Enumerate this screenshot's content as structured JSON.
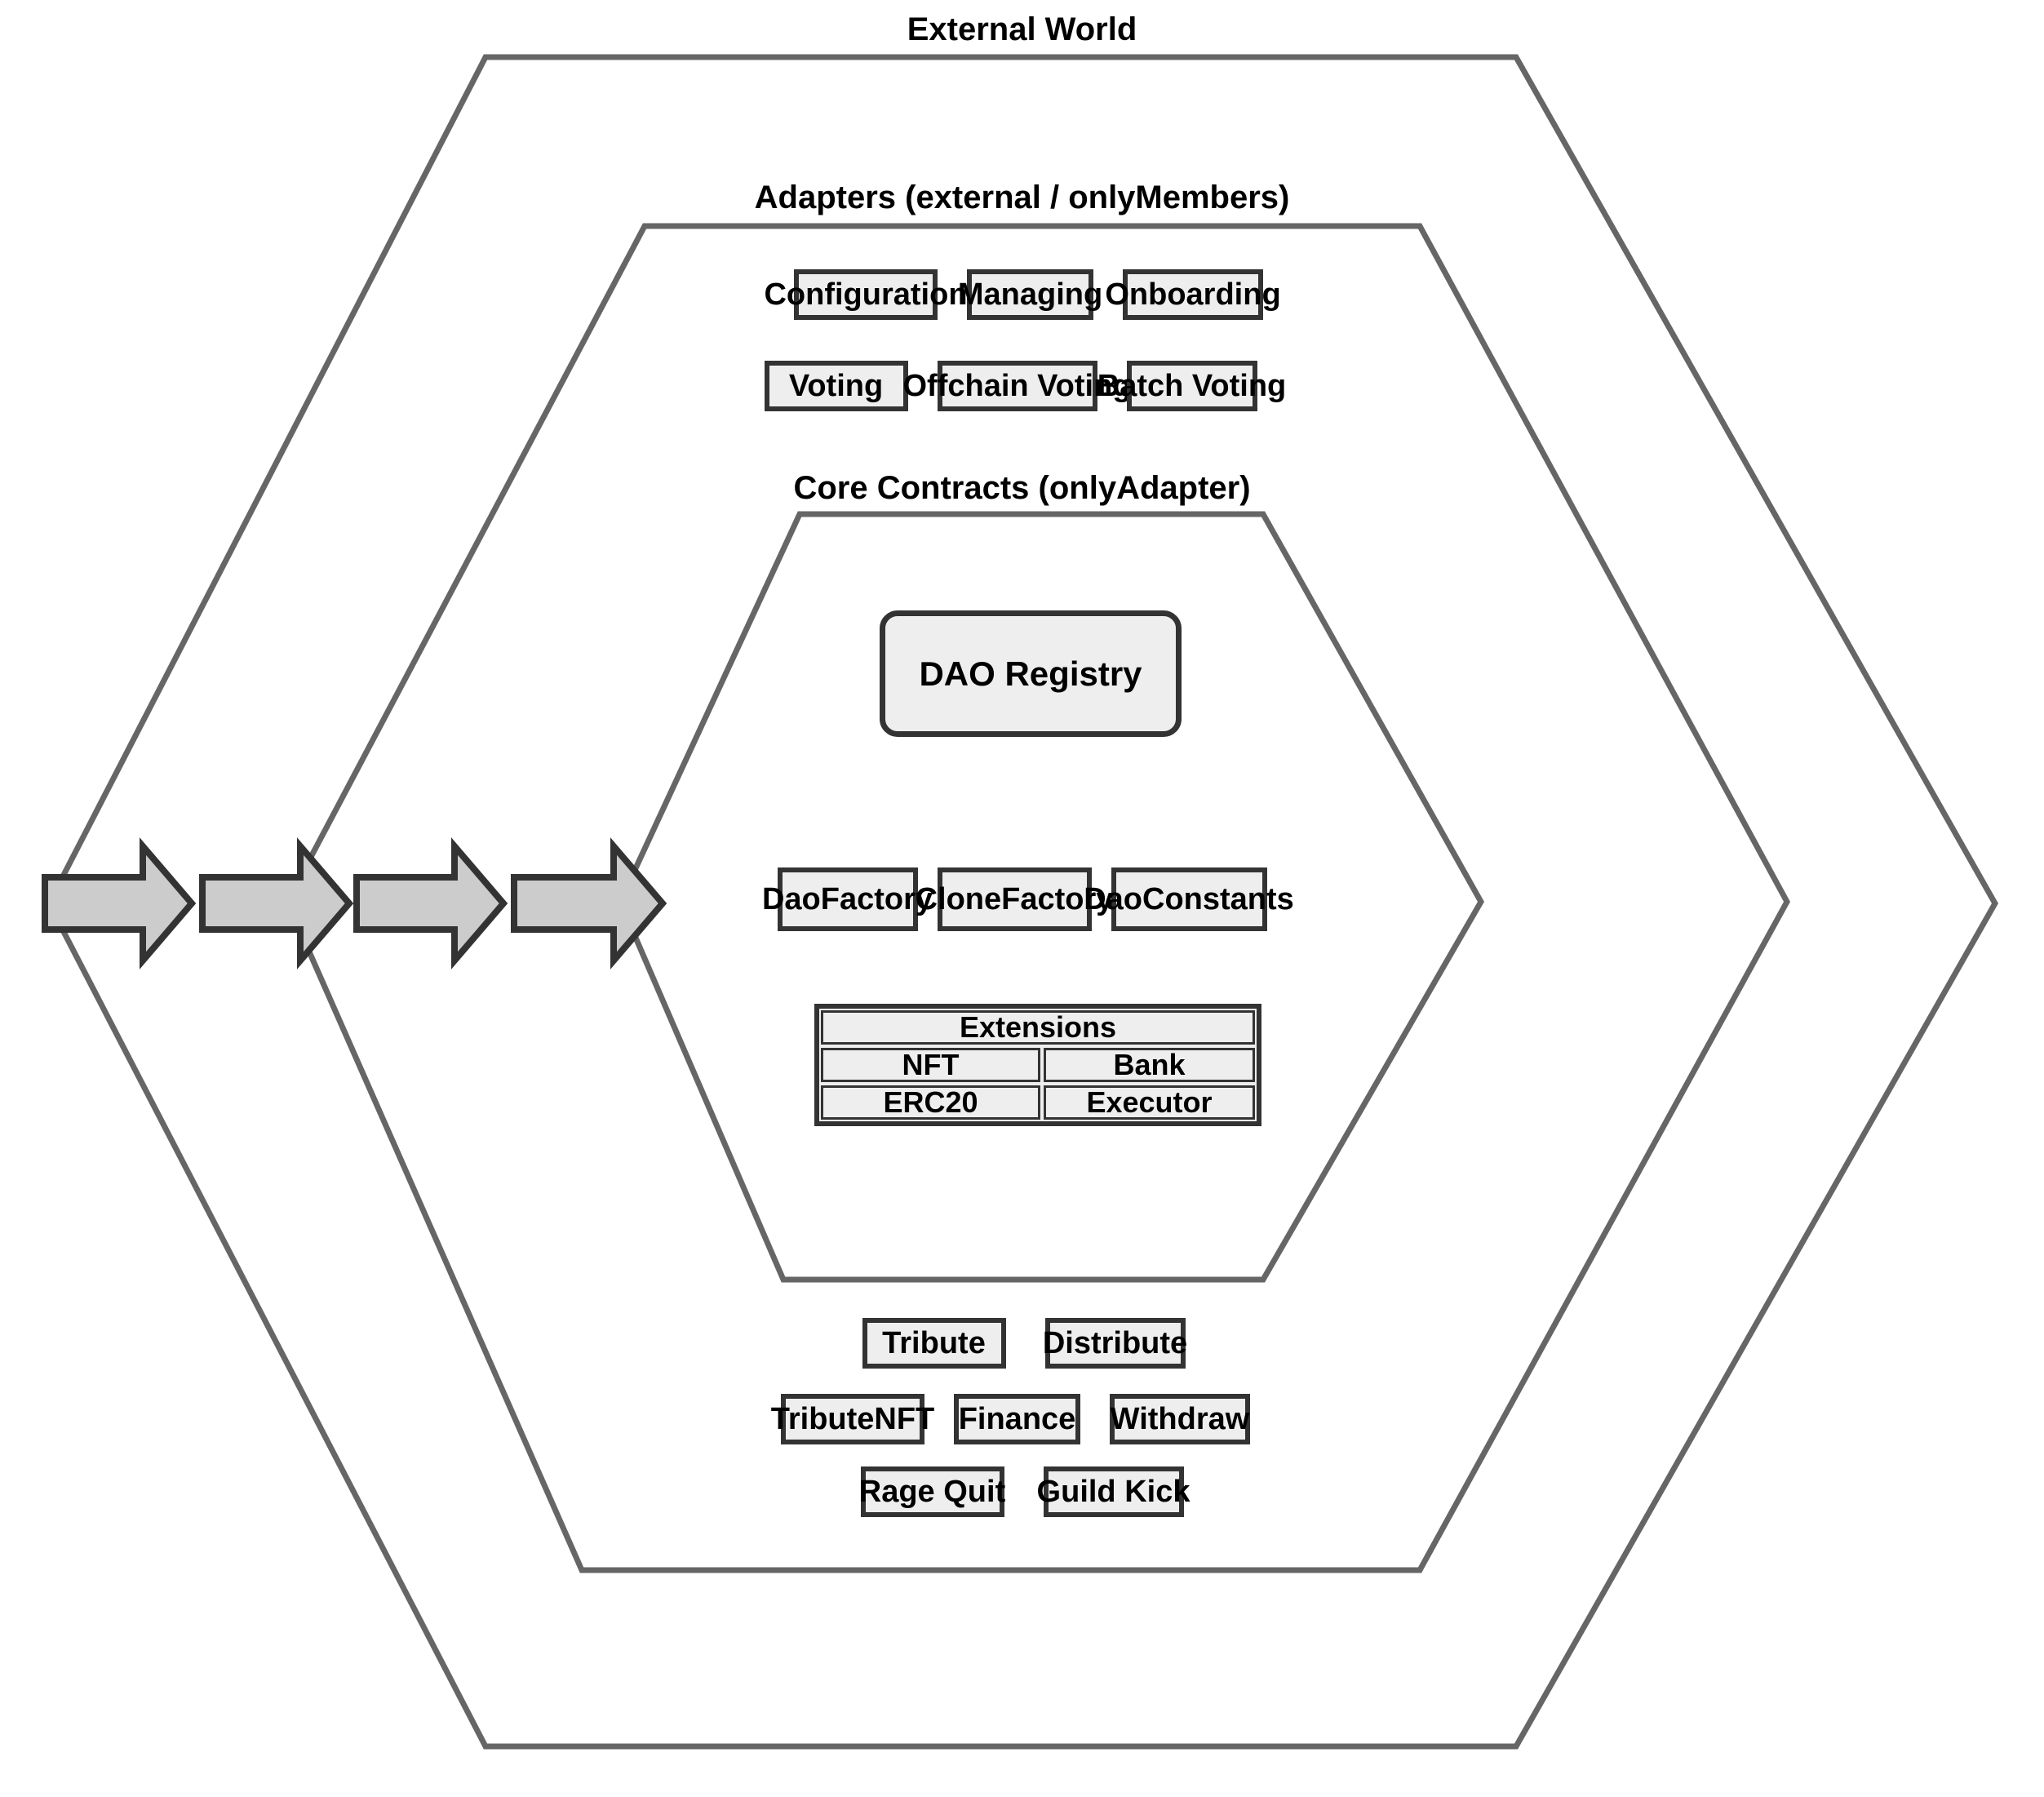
{
  "diagram": {
    "type": "layered-hexagon-architecture",
    "layers": [
      {
        "id": "external",
        "title": "External World"
      },
      {
        "id": "adapters",
        "title": "Adapters (external / onlyMembers)"
      },
      {
        "id": "core",
        "title": "Core Contracts (onlyAdapter)"
      }
    ],
    "colors": {
      "hexagon_stroke": "#666666",
      "node_fill": "#eeeeee",
      "node_stroke": "#333333",
      "arrow_fill": "#cccccc",
      "arrow_stroke": "#333333",
      "text": "#000000",
      "background": "#ffffff"
    }
  },
  "external": {
    "title": "External World"
  },
  "adapters": {
    "title": "Adapters (external / onlyMembers)",
    "top_rows": [
      {
        "items": [
          {
            "label": "Configuration",
            "width": 176
          },
          {
            "label": "Managing",
            "width": 155
          },
          {
            "label": "Onboarding",
            "width": 172
          }
        ],
        "gap": 36
      },
      {
        "items": [
          {
            "label": "Voting",
            "width": 176
          },
          {
            "label": "Offchain Voting",
            "width": 196
          },
          {
            "label": "Batch Voting",
            "width": 160
          }
        ],
        "gap": 36
      }
    ],
    "bottom_rows": [
      {
        "items": [
          {
            "label": "Tribute",
            "width": 176
          },
          {
            "label": "Distribute",
            "width": 172
          }
        ],
        "gap": 48
      },
      {
        "items": [
          {
            "label": "TributeNFT",
            "width": 176
          },
          {
            "label": "Finance",
            "width": 155
          },
          {
            "label": "Withdraw",
            "width": 172
          }
        ],
        "gap": 36
      },
      {
        "items": [
          {
            "label": "Rage Quit",
            "width": 176
          },
          {
            "label": "Guild Kick",
            "width": 172
          }
        ],
        "gap": 48
      }
    ]
  },
  "core": {
    "title": "Core Contracts (onlyAdapter)",
    "registry": {
      "label": "DAO Registry"
    },
    "factories": [
      {
        "label": "DaoFactory",
        "width": 172
      },
      {
        "label": "CloneFactory",
        "width": 189
      },
      {
        "label": "DaoConstants",
        "width": 191
      }
    ],
    "extensions": {
      "header": "Extensions",
      "cells": [
        [
          "NFT",
          "Bank"
        ],
        [
          "ERC20",
          "Executor"
        ]
      ]
    }
  },
  "flow_arrows": [
    {
      "name": "arrow-into-external-world"
    },
    {
      "name": "arrow-into-adapters"
    },
    {
      "name": "arrow-toward-core"
    },
    {
      "name": "arrow-into-core-contracts"
    }
  ]
}
